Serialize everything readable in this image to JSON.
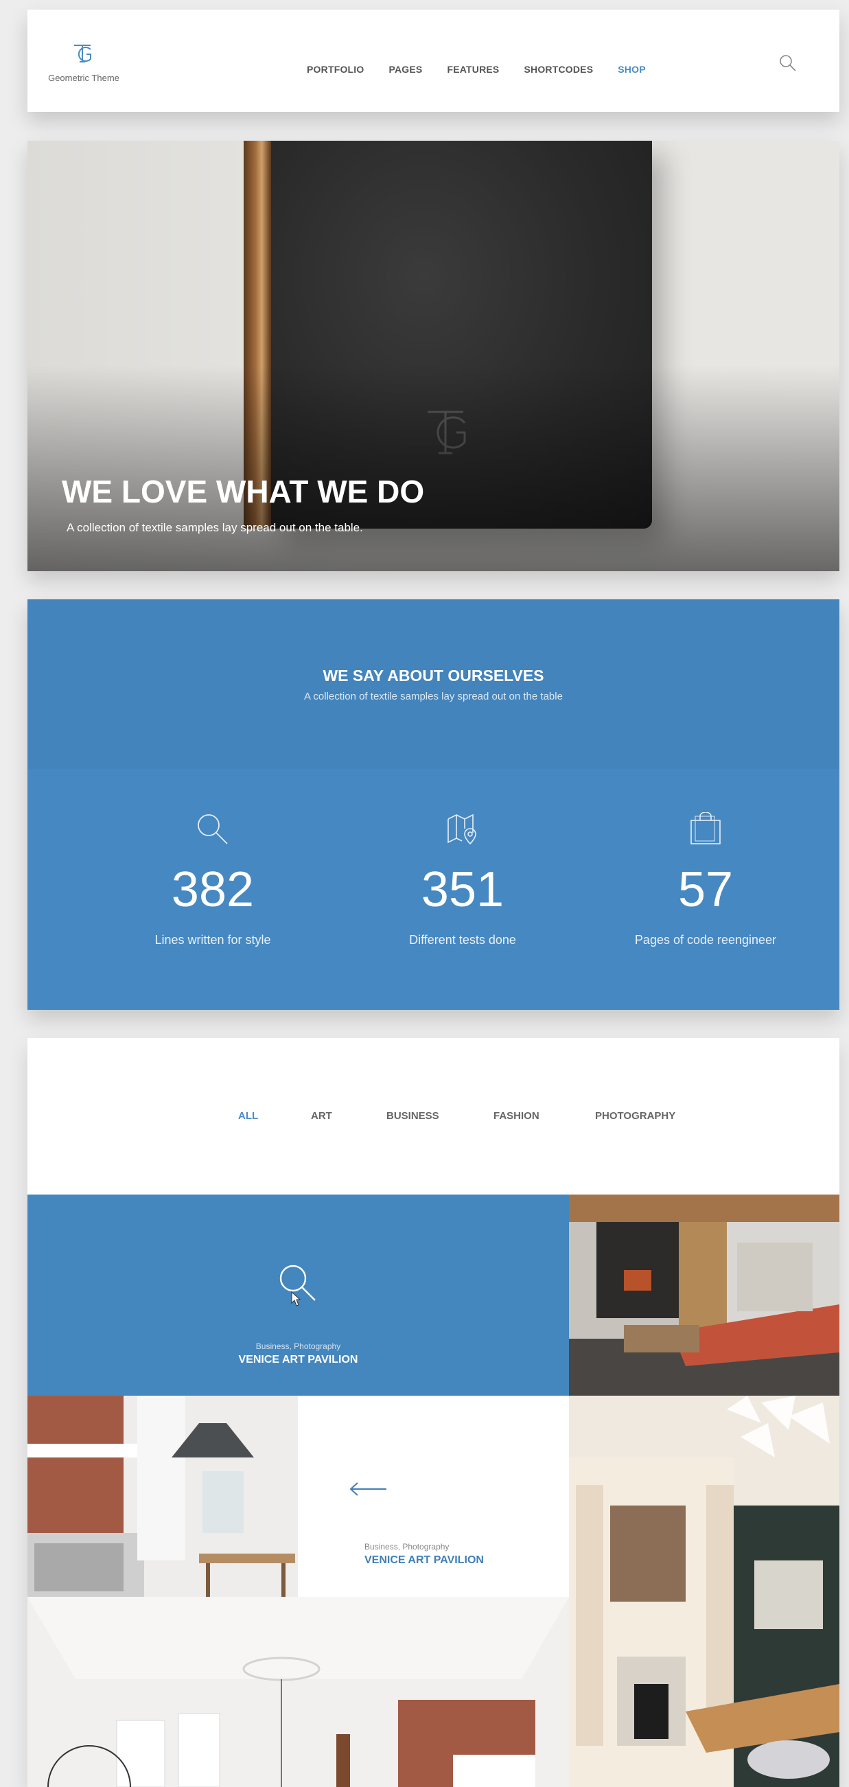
{
  "header": {
    "logo_text": "Geometric Theme",
    "nav": [
      "PORTFOLIO",
      "PAGES",
      "FEATURES",
      "SHORTCODES",
      "SHOP"
    ],
    "active_nav": "SHOP",
    "search_icon": "search-icon"
  },
  "hero": {
    "title": "WE LOVE WHAT WE DO",
    "subtitle": "A collection of textile samples lay spread out on the table."
  },
  "about": {
    "title": "WE SAY ABOUT OURSELVES",
    "subtitle": "A collection of textile samples lay spread out on the table",
    "stats": [
      {
        "icon": "search-icon",
        "value": "382",
        "label": "Lines written for style"
      },
      {
        "icon": "map-pin-icon",
        "value": "351",
        "label": "Different tests done"
      },
      {
        "icon": "shopping-bag-icon",
        "value": "57",
        "label": "Pages of code reengineer"
      }
    ]
  },
  "portfolio": {
    "filters": [
      "ALL",
      "ART",
      "BUSINESS",
      "FASHION",
      "PHOTOGRAPHY"
    ],
    "active_filter": "ALL",
    "items": [
      {
        "category": "Business, Photography",
        "title": "VENICE ART PAVILION"
      },
      {
        "category": "Business, Photography",
        "title": "VENICE ART PAVILION"
      }
    ]
  },
  "colors": {
    "accent": "#4a8bc6",
    "stats_bg": "#4486be",
    "page_bg": "#ededed"
  }
}
